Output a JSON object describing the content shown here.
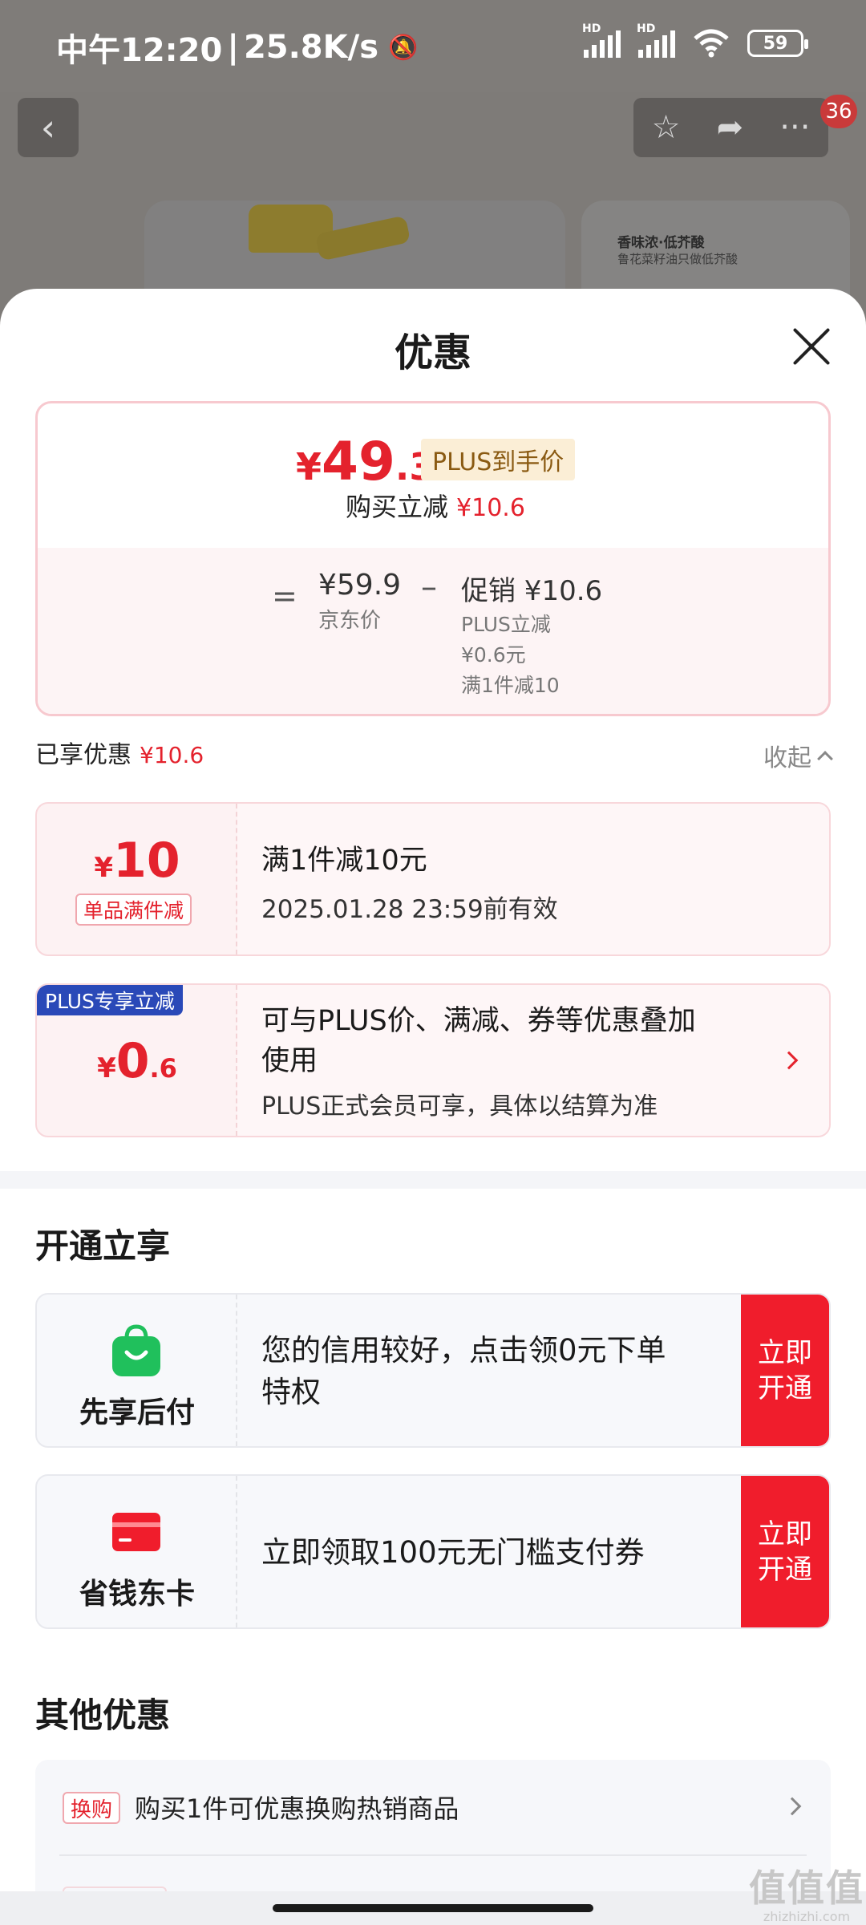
{
  "status_bar": {
    "time": "中午12:20",
    "network_speed": "25.8K/s",
    "battery": "59",
    "signal_label": "HD"
  },
  "background_page": {
    "cart_badge": "36",
    "product_card_title": "香味浓·低芥酸",
    "product_card_subtitle": "鲁花菜籽油只做低芥酸"
  },
  "sheet": {
    "title": "优惠",
    "price": {
      "currency": "¥",
      "integer": "49",
      "decimal": ".3",
      "plus_label": "PLUS到手价",
      "buy_reduce_label": "购买立减",
      "buy_reduce_amount": "¥10.6"
    },
    "breakdown": {
      "equals": "=",
      "jd_price": "¥59.9",
      "jd_label": "京东价",
      "minus": "–",
      "promo": "促销 ¥10.6",
      "promo_lines": [
        "PLUS立减",
        "¥0.6元",
        "满1件减10"
      ]
    },
    "enjoyed": {
      "label": "已享优惠",
      "amount": "¥10.6",
      "collapse_label": "收起"
    },
    "coupon_1": {
      "currency": "¥",
      "amount": "10",
      "tag": "单品满件减",
      "title": "满1件减10元",
      "validity": "2025.01.28 23:59前有效"
    },
    "coupon_2": {
      "ribbon": "PLUS专享立减",
      "currency": "¥",
      "amount": "0",
      "decimal": ".6",
      "title_line1": "可与PLUS价、满减、券等优惠叠加",
      "title_line2": "使用",
      "subtitle": "PLUS正式会员可享，具体以结算为准"
    },
    "open_section": {
      "title": "开通立享",
      "offers": [
        {
          "name": "先享后付",
          "text_line1": "您的信用较好，点击领0元下单",
          "text_line2": "特权",
          "cta_line1": "立即",
          "cta_line2": "开通"
        },
        {
          "name": "省钱东卡",
          "text_line1": "立即领取100元无门槛支付券",
          "cta_line1": "立即",
          "cta_line2": "开通"
        }
      ]
    },
    "other_section": {
      "title": "其他优惠",
      "items": [
        {
          "tag": "换购",
          "text": "购买1件可优惠换购热销商品"
        }
      ]
    }
  },
  "watermark": {
    "line1": "值值值",
    "line2": "zhizhizhi.com"
  },
  "colors": {
    "accent_red": "#e4222d",
    "cta_red": "#f01d2c",
    "plus_blue": "#2a49b8",
    "pay_green": "#20c05c"
  }
}
